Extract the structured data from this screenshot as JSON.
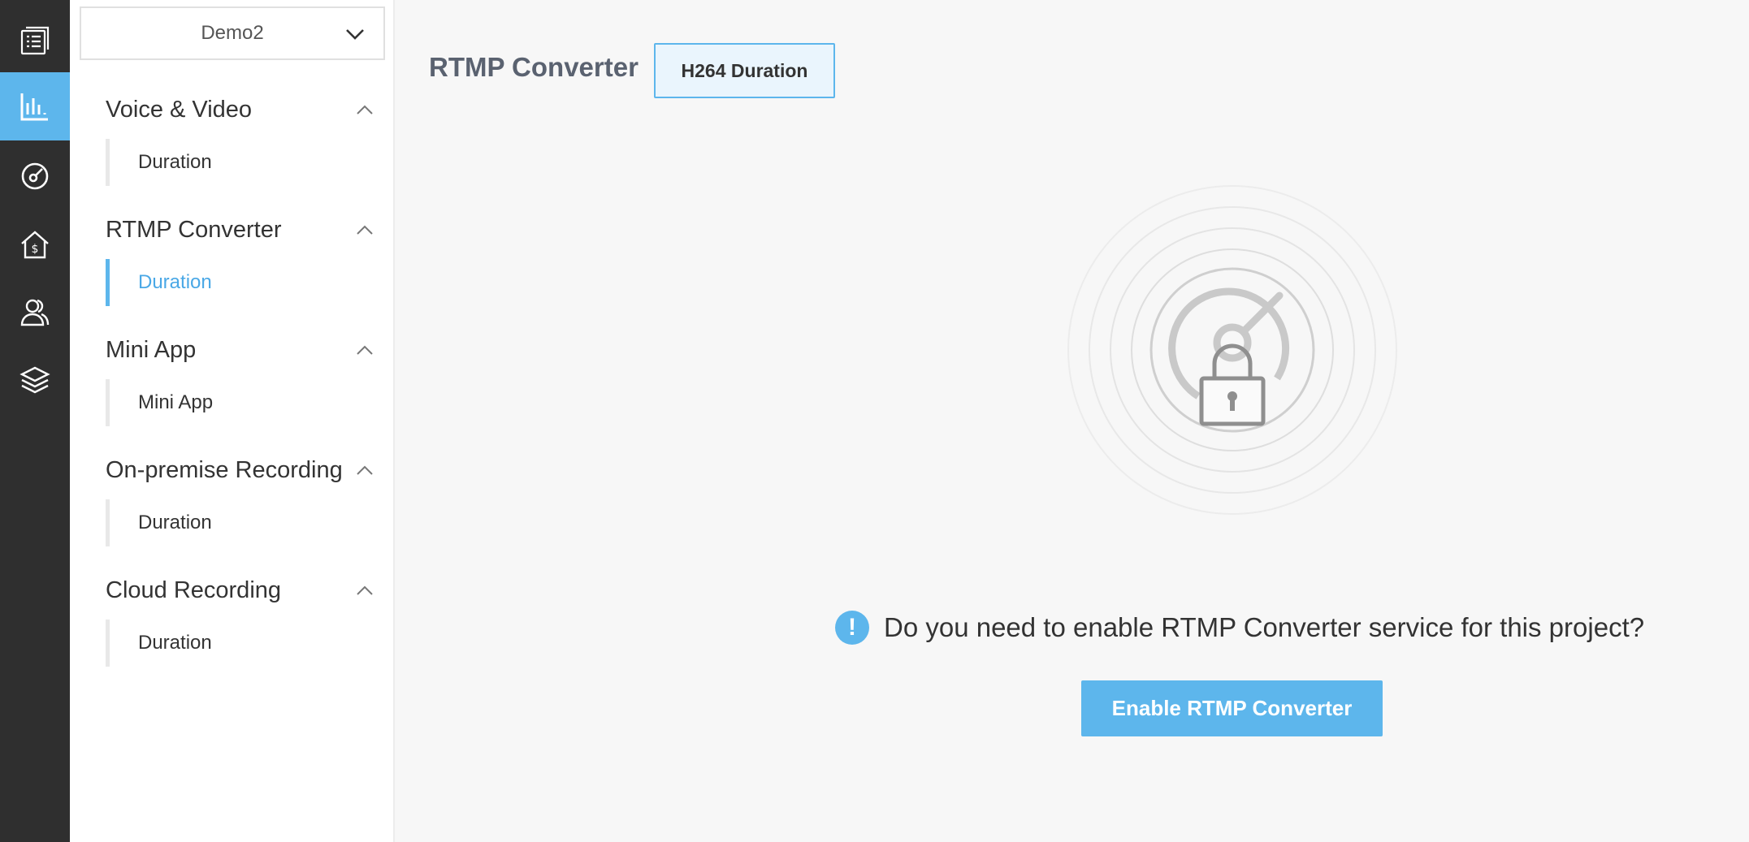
{
  "rail": {
    "items": [
      {
        "icon": "document-list-icon"
      },
      {
        "icon": "bar-chart-icon",
        "active": true
      },
      {
        "icon": "gauge-icon"
      },
      {
        "icon": "billing-home-icon"
      },
      {
        "icon": "users-icon"
      },
      {
        "icon": "layers-icon"
      }
    ],
    "accent": "#5db6ec"
  },
  "sidebar": {
    "project_select": {
      "value": "Demo2"
    },
    "sections": [
      {
        "title": "Voice & Video",
        "items": [
          {
            "label": "Duration"
          }
        ]
      },
      {
        "title": "RTMP Converter",
        "items": [
          {
            "label": "Duration",
            "active": true
          }
        ]
      },
      {
        "title": "Mini App",
        "items": [
          {
            "label": "Mini App"
          }
        ]
      },
      {
        "title": "On-premise Recording",
        "items": [
          {
            "label": "Duration"
          }
        ]
      },
      {
        "title": "Cloud Recording",
        "items": [
          {
            "label": "Duration"
          }
        ]
      }
    ]
  },
  "main": {
    "title": "RTMP Converter",
    "tab": {
      "label": "H264 Duration"
    },
    "notice": {
      "icon_char": "!",
      "text": "Do you need to enable RTMP Converter service for this project?"
    },
    "enable_button": {
      "label": "Enable RTMP Converter"
    }
  }
}
